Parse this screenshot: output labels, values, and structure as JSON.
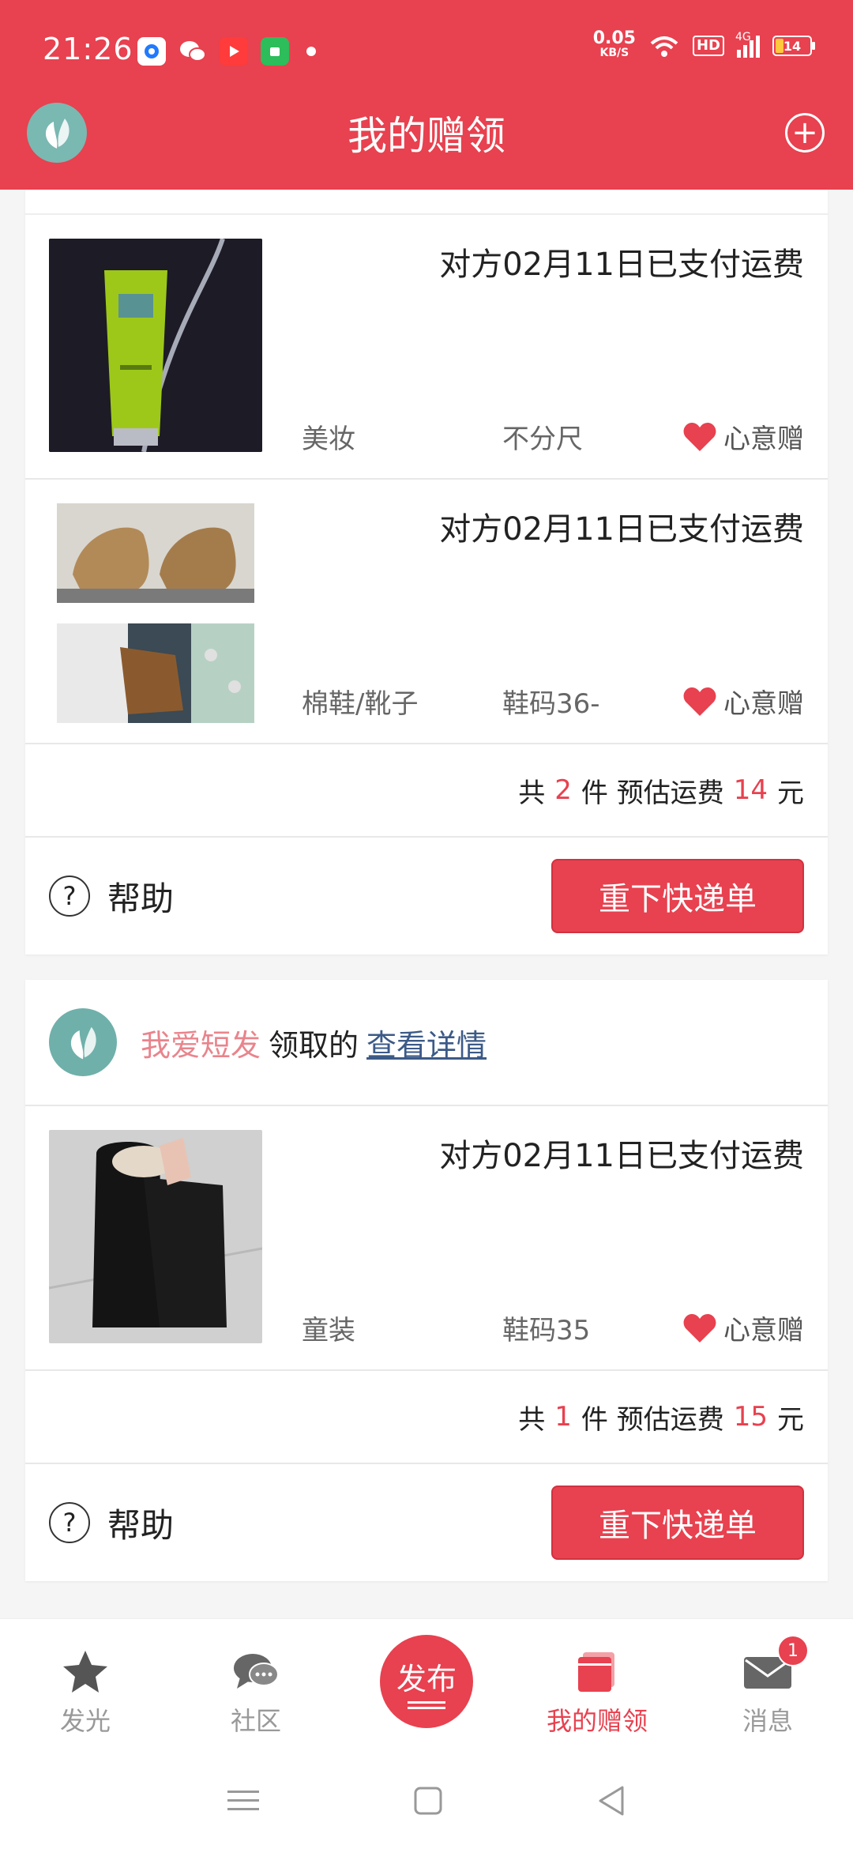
{
  "status_bar": {
    "time": "21:26",
    "net_speed_value": "0.05",
    "net_speed_unit": "KB/S",
    "hd_label": "HD",
    "network": "4G",
    "battery": "14",
    "battery_level": 0.14
  },
  "header": {
    "title": "我的赠领",
    "add_icon": "plus-circle-icon"
  },
  "cards": [
    {
      "items": [
        {
          "status": "对方02月11日已支付运费",
          "category": "美妆",
          "size": "不分尺",
          "gift_type": "心意赠"
        },
        {
          "status": "对方02月11日已支付运费",
          "category": "棉鞋/靴子",
          "size": "鞋码36-",
          "gift_type": "心意赠"
        }
      ],
      "summary": {
        "prefix": "共",
        "count": "2",
        "mid": "件 预估运费",
        "fee": "14",
        "suffix": "元"
      },
      "help_label": "帮助",
      "reorder_label": "重下快递单"
    },
    {
      "donor": {
        "name": "我爱短发",
        "verb": "领取的",
        "link": "查看详情"
      },
      "items": [
        {
          "status": "对方02月11日已支付运费",
          "category": "童装",
          "size": "鞋码35",
          "gift_type": "心意赠"
        }
      ],
      "summary": {
        "prefix": "共",
        "count": "1",
        "mid": "件 预估运费",
        "fee": "15",
        "suffix": "元"
      },
      "help_label": "帮助",
      "reorder_label": "重下快递单"
    }
  ],
  "bottom_nav": {
    "tabs": [
      {
        "label": "发光",
        "icon": "star-icon"
      },
      {
        "label": "社区",
        "icon": "chat-bubbles-icon"
      },
      {
        "label": "发布",
        "icon": "publish-icon"
      },
      {
        "label": "我的赠领",
        "icon": "gift-box-icon",
        "active": true
      },
      {
        "label": "消息",
        "icon": "mail-icon",
        "badge": "1"
      }
    ]
  },
  "colors": {
    "accent": "#e8414f",
    "donor_name": "#e9848c",
    "link": "#3c5a87"
  }
}
